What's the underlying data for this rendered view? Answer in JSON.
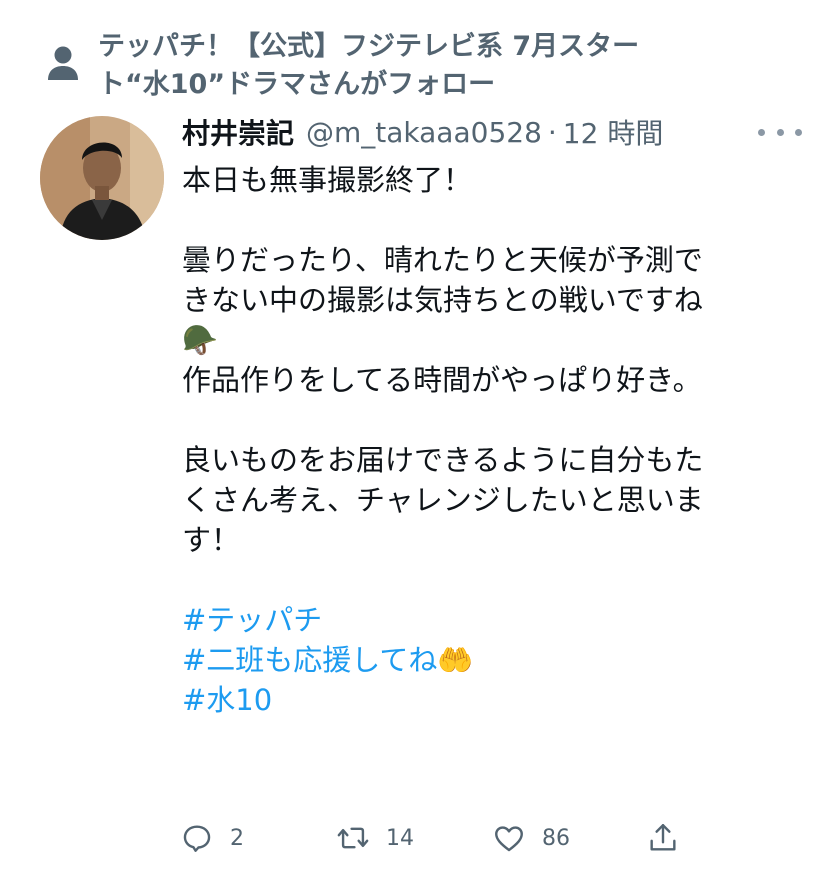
{
  "context": {
    "line1": "テッパチ！【公式】フジテレビ系 7月スター",
    "line2": "ト“水10”ドラマさんがフォロー"
  },
  "tweet": {
    "display_name": "村井崇記",
    "handle": "@m_takaaa0528",
    "separator": "·",
    "time": "12 時間",
    "lines": [
      "本日も無事撮影終了！",
      "",
      "曇りだったり、晴れたりと天候が予測で",
      "きない中の撮影は気持ちとの戦いですね",
      "🪖",
      "作品作りをしてる時間がやっぱり好き。",
      "",
      "良いものをお届けできるように自分もた",
      "くさん考え、チャレンジしたいと思いま",
      "す！",
      ""
    ],
    "hashtags": [
      "#テッパチ",
      "#二班も応援してね🤲",
      "#水10"
    ]
  },
  "actions": {
    "reply_count": "2",
    "retweet_count": "14",
    "like_count": "86"
  },
  "icons": {
    "context": "person-icon",
    "more": "more-icon",
    "reply": "reply-icon",
    "retweet": "retweet-icon",
    "like": "heart-icon",
    "share": "share-icon"
  },
  "colors": {
    "text": "#0f1419",
    "secondary": "#536471",
    "hashtag": "#1d9bf0"
  }
}
